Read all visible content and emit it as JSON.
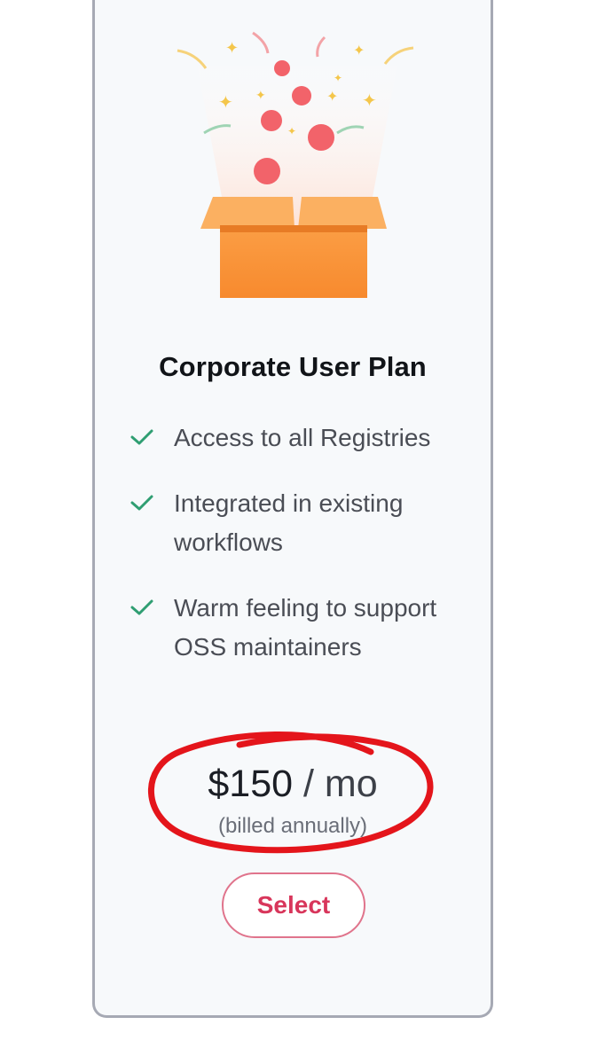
{
  "plan": {
    "title": "Corporate User Plan",
    "features": [
      "Access to all Registries",
      "Integrated in existing workflows",
      "Warm feeling to support OSS maintainers"
    ],
    "price": "$150",
    "price_separator": " / ",
    "price_period": "mo",
    "billing_note": "(billed annually)",
    "select_label": "Select"
  },
  "icons": {
    "feature_check": "check-icon",
    "illustration": "gift-box-confetti-illustration"
  },
  "colors": {
    "accent": "#d8365b",
    "check": "#2f9e72",
    "annotation": "#e4151b",
    "box": "#f7953a"
  }
}
